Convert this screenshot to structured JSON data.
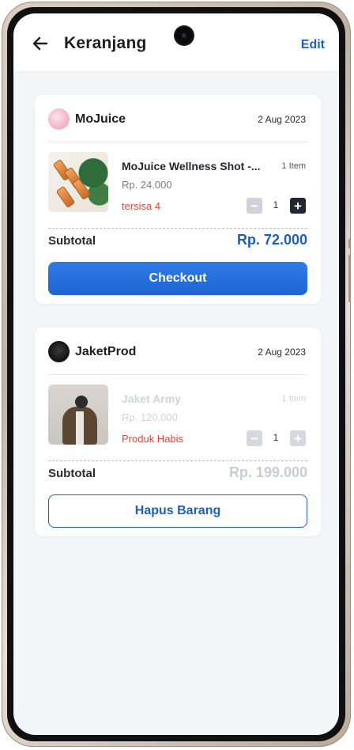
{
  "header": {
    "title": "Keranjang",
    "edit_label": "Edit"
  },
  "carts": [
    {
      "store_name": "MoJuice",
      "date": "2 Aug 2023",
      "product_name": "MoJuice Wellness Shot -...",
      "item_count": "1 Item",
      "price": "Rp. 24.000",
      "stock_label": "tersisa 4",
      "quantity": "1",
      "subtotal_label": "Subtotal",
      "subtotal_value": "Rp. 72.000",
      "action_label": "Checkout"
    },
    {
      "store_name": "JaketProd",
      "date": "2 Aug 2023",
      "product_name": "Jaket Army",
      "item_count": "1 Item",
      "price": "Rp. 120.000",
      "stock_label": "Produk Habis",
      "quantity": "1",
      "subtotal_label": "Subtotal",
      "subtotal_value": "Rp. 199.000",
      "action_label": "Hapus Barang"
    }
  ],
  "colors": {
    "accent": "#1d5fb8",
    "primary_button": "#2f7be6",
    "warning_text": "#d84a3a",
    "screen_background": "#f3f5f9"
  },
  "icons": {
    "back": "arrow-left-icon",
    "minus": "minus-icon",
    "plus": "plus-icon"
  }
}
